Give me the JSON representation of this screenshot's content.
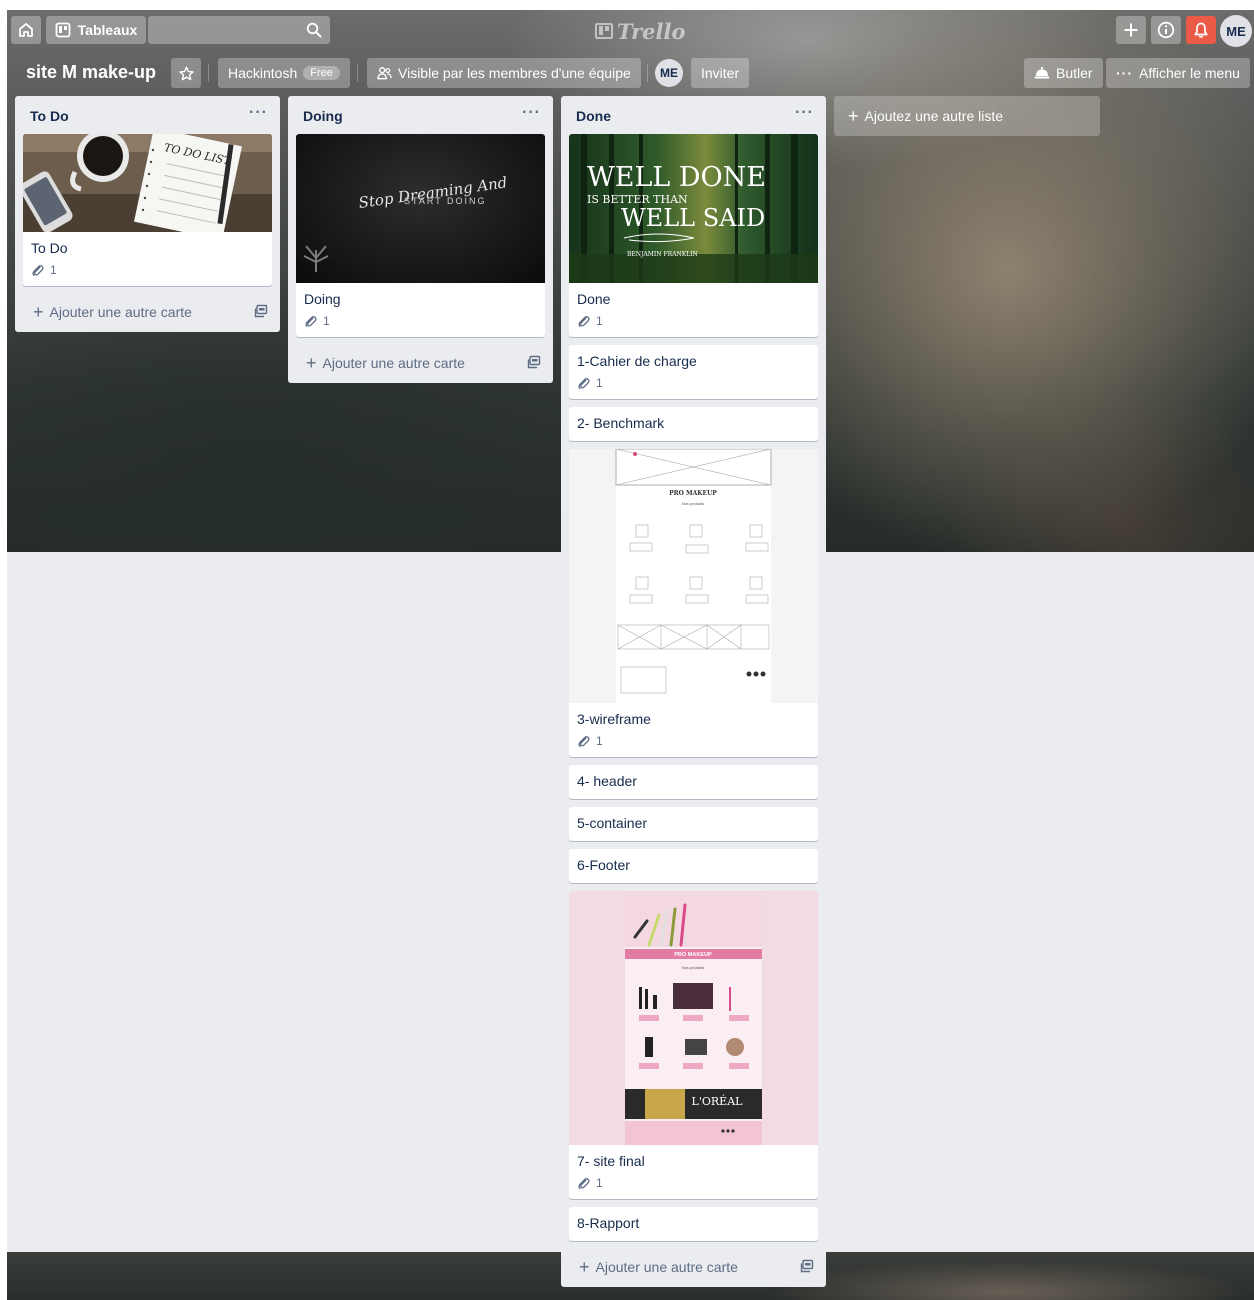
{
  "header": {
    "boards_label": "Tableaux",
    "logo_text": "Trello",
    "avatar_initials": "ME"
  },
  "board": {
    "title": "site M make-up",
    "team_name": "Hackintosh",
    "team_plan": "Free",
    "visibility": "Visible par les membres d'une équipe",
    "member_initials": "ME",
    "invite_label": "Inviter",
    "butler_label": "Butler",
    "menu_label": "Afficher le menu",
    "add_list_label": "Ajoutez une autre liste"
  },
  "colors": {
    "notification": "#eb5a46",
    "list_bg": "#ebecf0",
    "text": "#172b4d"
  },
  "lists": [
    {
      "title": "To Do",
      "add_card_label": "Ajouter une autre carte",
      "cards": [
        {
          "title": "To Do",
          "attachments": "1",
          "cover_text": "TO DO LIST"
        }
      ]
    },
    {
      "title": "Doing",
      "add_card_label": "Ajouter une autre carte",
      "cards": [
        {
          "title": "Doing",
          "attachments": "1",
          "cover_text_1": "Stop Dreaming And",
          "cover_text_2": "START DOING"
        }
      ]
    },
    {
      "title": "Done",
      "add_card_label": "Ajouter une autre carte",
      "cards": [
        {
          "title": "Done",
          "attachments": "1",
          "cover_line_1": "WELL DONE",
          "cover_line_2": "IS BETTER THAN",
          "cover_line_3": "WELL SAID",
          "cover_line_4": "BENJAMIN FRANKLIN"
        },
        {
          "title": "1-Cahier de charge",
          "attachments": "1"
        },
        {
          "title": "2- Benchmark"
        },
        {
          "title": "3-wireframe",
          "attachments": "1",
          "cover_heading": "PRO MAKEUP",
          "cover_sub": "Nos produits"
        },
        {
          "title": "4- header"
        },
        {
          "title": "5-container"
        },
        {
          "title": "6-Footer"
        },
        {
          "title": "7- site final",
          "attachments": "1",
          "cover_heading": "PRO MAKEUP",
          "cover_sub": "Nos produits",
          "cover_brand": "L'ORÉAL"
        },
        {
          "title": "8-Rapport"
        }
      ]
    }
  ]
}
